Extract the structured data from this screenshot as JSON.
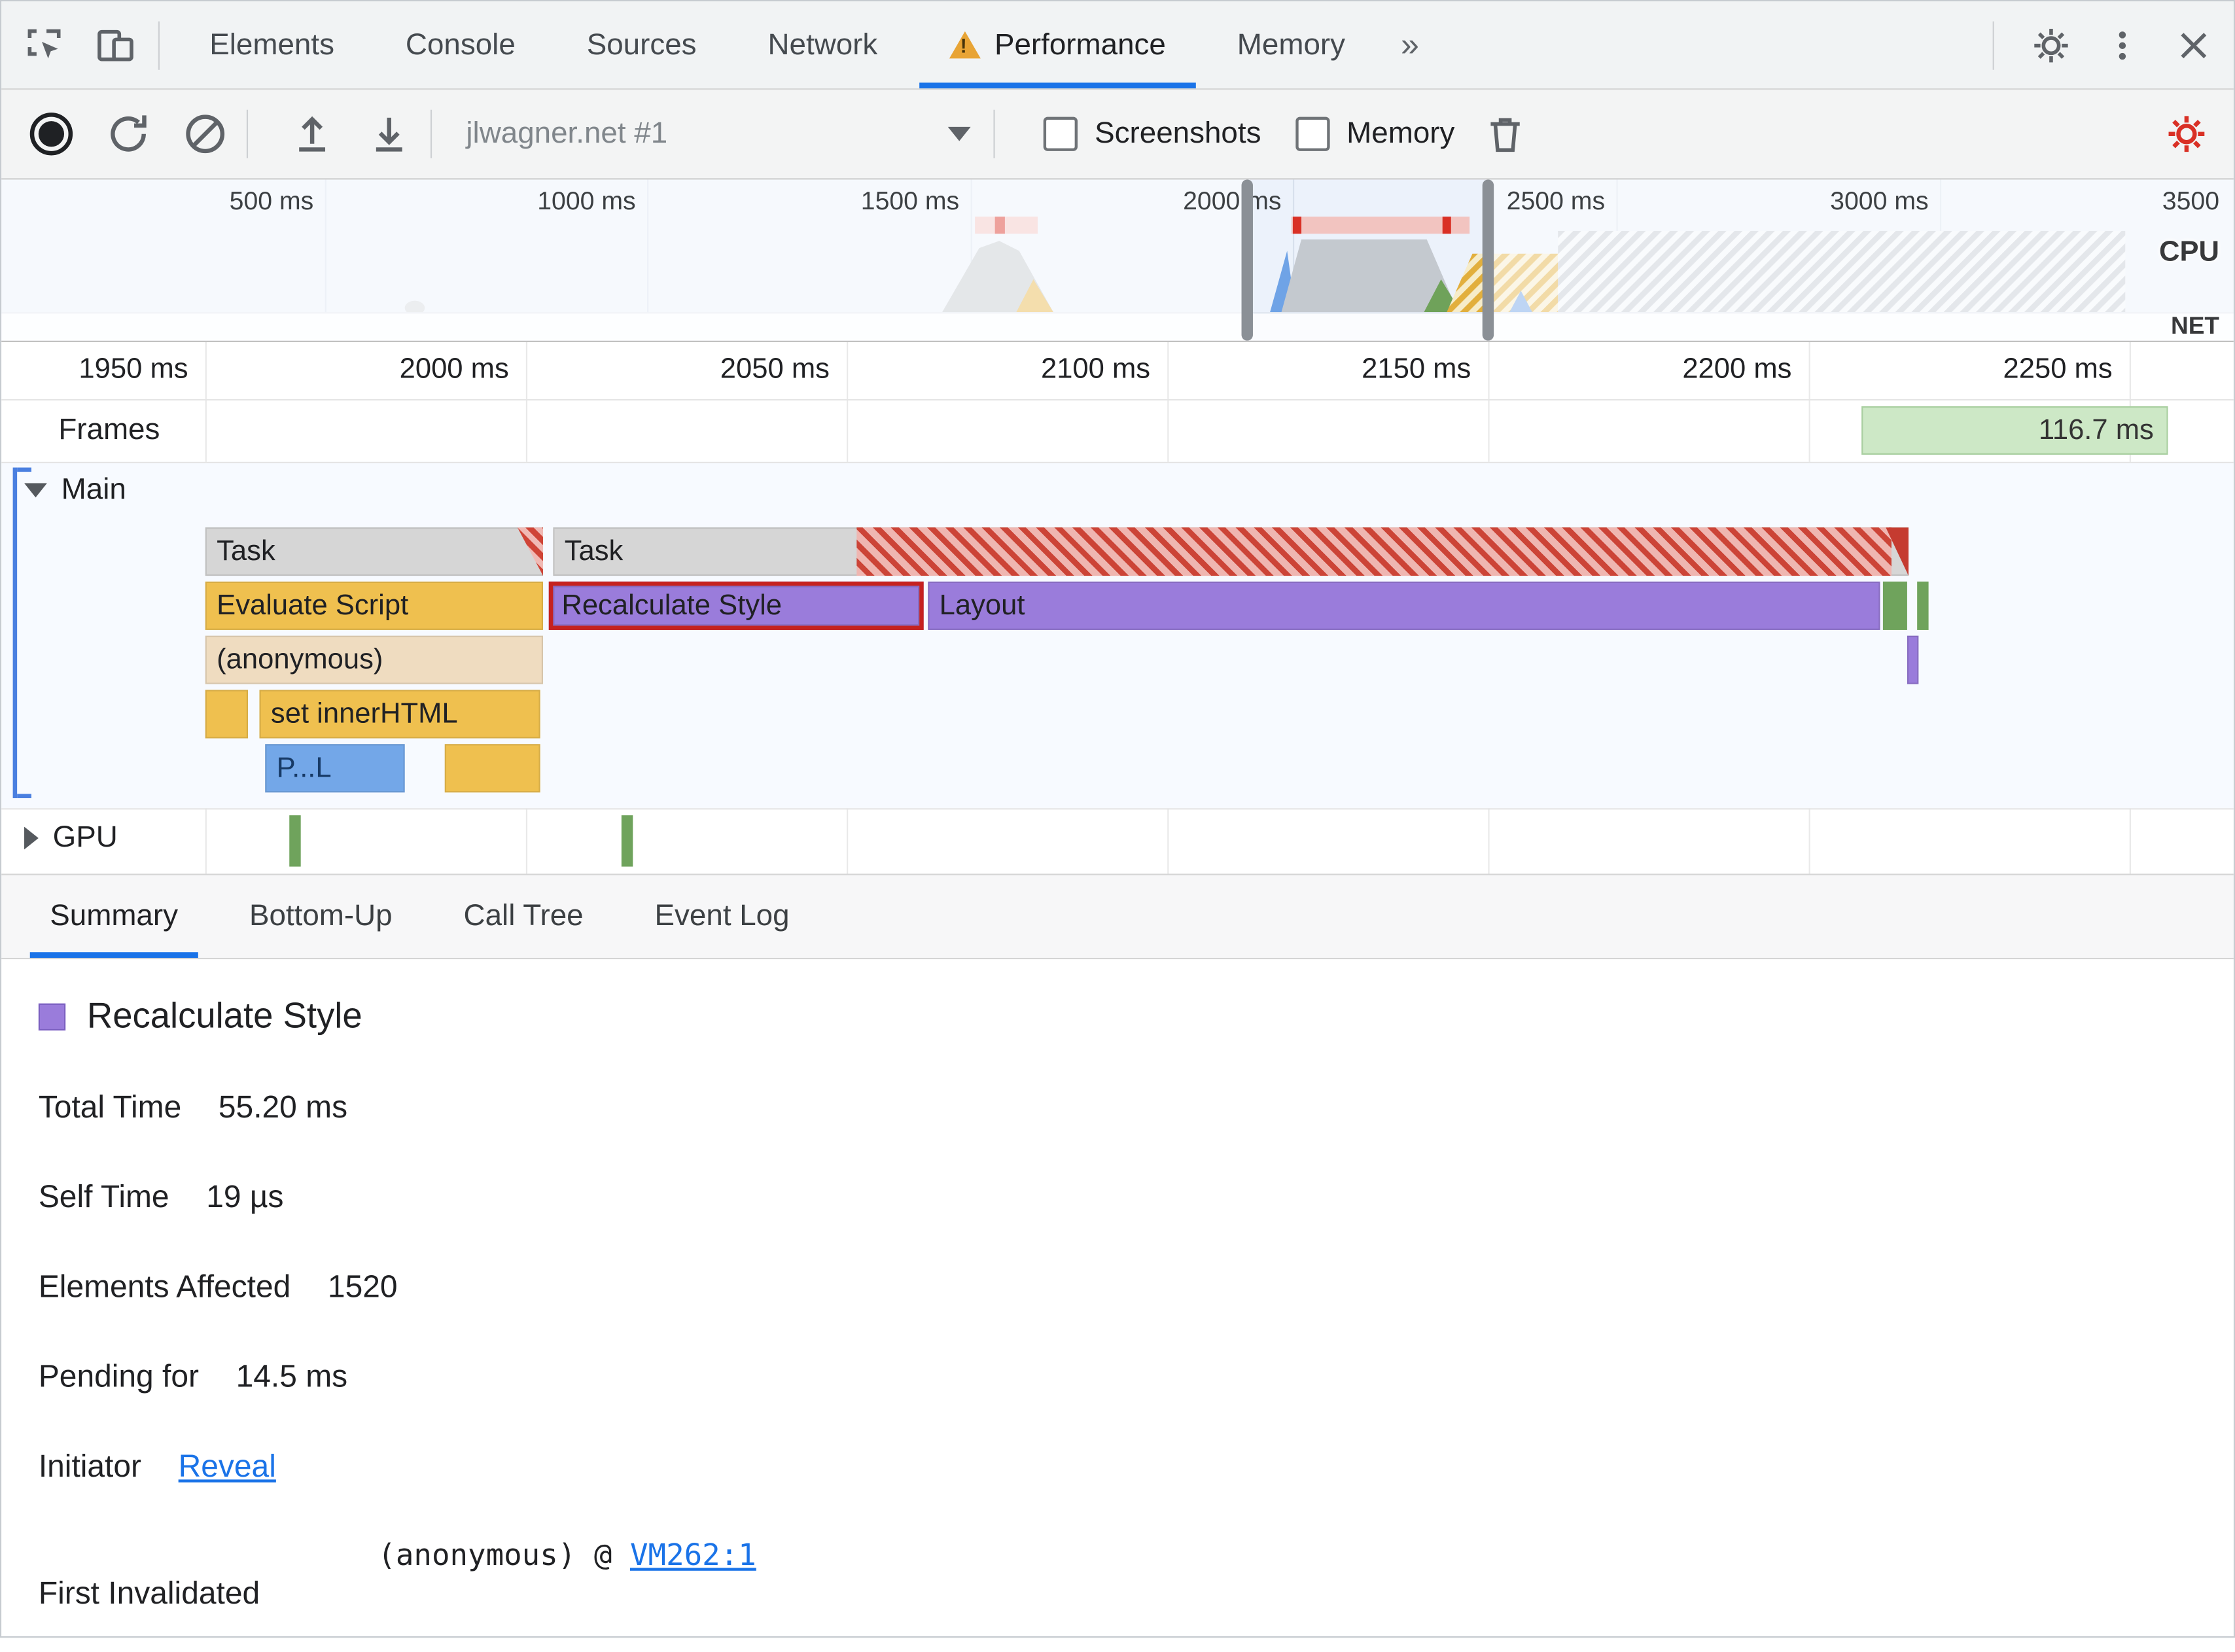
{
  "colors": {
    "accent": "#1a73e8",
    "warning": "#e37400",
    "record-red": "#d93025",
    "scripting-yellow": "#efc04f",
    "rendering-purple": "#9a7cdb",
    "painting-green": "#6fa35c",
    "loading-blue": "#73a7e8",
    "task-gray": "#d6d6d6",
    "function-tan": "#efdcc0",
    "longtask-red": "#cc4437",
    "longtask-pink": "#efb6b1",
    "frame-green": "#cde8c6",
    "highlight-red": "#c5221f",
    "link-blue": "#1a73e8"
  },
  "devtools_tabs": {
    "items": [
      "Elements",
      "Console",
      "Sources",
      "Network",
      "Performance",
      "Memory"
    ],
    "active": "Performance",
    "more_symbol": "»"
  },
  "perf_toolbar": {
    "profile_select": "jlwagner.net #1",
    "screenshots_label": "Screenshots",
    "memory_label": "Memory"
  },
  "overview": {
    "ticks": [
      "500 ms",
      "1000 ms",
      "1500 ms",
      "2000 ms",
      "2500 ms",
      "3000 ms",
      "3500"
    ],
    "cpu_label": "CPU",
    "net_label": "NET"
  },
  "ruler_ticks": [
    "1950 ms",
    "2000 ms",
    "2050 ms",
    "2100 ms",
    "2150 ms",
    "2200 ms",
    "2250 ms"
  ],
  "frames": {
    "label": "Frames",
    "duration": "116.7 ms"
  },
  "tracks": {
    "main_label": "Main",
    "gpu_label": "GPU"
  },
  "flame": {
    "task1": "Task",
    "task2": "Task",
    "evaluate_script": "Evaluate Script",
    "recalculate_style": "Recalculate Style",
    "layout": "Layout",
    "anonymous": "(anonymous)",
    "set_inner_html": "set innerHTML",
    "profile_call": "P...L"
  },
  "bottom_tabs": [
    "Summary",
    "Bottom-Up",
    "Call Tree",
    "Event Log"
  ],
  "summary": {
    "legend": "Recalculate Style",
    "rows": [
      {
        "label": "Total Time",
        "value": "55.20 ms"
      },
      {
        "label": "Self Time",
        "value": "19 µs"
      },
      {
        "label": "Elements Affected",
        "value": "1520"
      },
      {
        "label": "Pending for",
        "value": "14.5 ms"
      }
    ],
    "initiator_label": "Initiator",
    "initiator_link": "Reveal",
    "first_invalidated_label": "First Invalidated",
    "first_invalidated_code": "(anonymous) @",
    "first_invalidated_link": "VM262:1"
  }
}
